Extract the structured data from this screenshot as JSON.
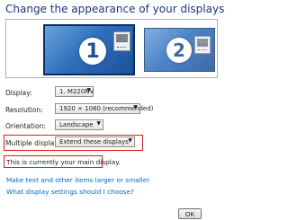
{
  "header": {
    "title": "Change the appearance of your displays"
  },
  "monitors": [
    {
      "number": "1",
      "selected": true
    },
    {
      "number": "2",
      "selected": false
    }
  ],
  "settings": {
    "display": {
      "label": "Display:",
      "value": "1. M220NV"
    },
    "resolution": {
      "label": "Resolution:",
      "value": "1920 × 1080 (recommended)"
    },
    "orientation": {
      "label": "Orientation:",
      "value": "Landscape"
    },
    "multiple_displays": {
      "label": "Multiple displays:",
      "value": "Extend these displays"
    }
  },
  "status": {
    "main_display_text": "This is currently your main display."
  },
  "links": [
    "Make text and other items larger or smaller",
    "What display settings should I choose?"
  ],
  "buttons": {
    "ok": "OK"
  },
  "colors": {
    "highlight": "#d52020",
    "link": "#0066cc",
    "title": "#1e3287",
    "monitor": "#2f6fbd"
  }
}
